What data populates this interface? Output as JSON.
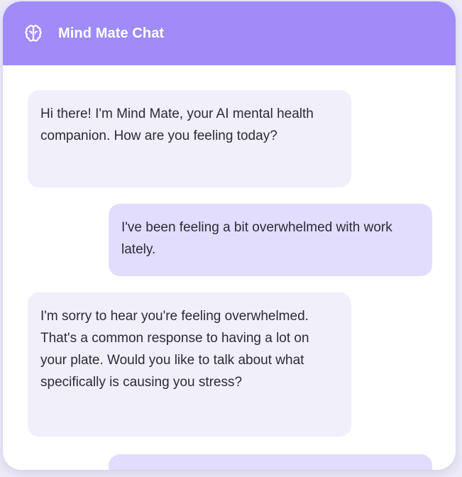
{
  "header": {
    "title": "Mind Mate Chat",
    "icon": "brain-icon",
    "background": "#a08bf8"
  },
  "messages": [
    {
      "sender": "bot",
      "text": "Hi there! I'm Mind Mate, your AI mental health companion. How are you feeling today?"
    },
    {
      "sender": "user",
      "text": "I've been feeling a bit overwhelmed with work lately."
    },
    {
      "sender": "bot",
      "text": "I'm sorry to hear you're feeling overwhelmed. That's a common response to having a lot on your plate. Would you like to talk about what specifically is causing you stress?"
    },
    {
      "sender": "user",
      "text": ""
    }
  ],
  "colors": {
    "bot_bubble": "#f1effa",
    "user_bubble": "#e2dcfd",
    "text": "#2b2b38"
  }
}
